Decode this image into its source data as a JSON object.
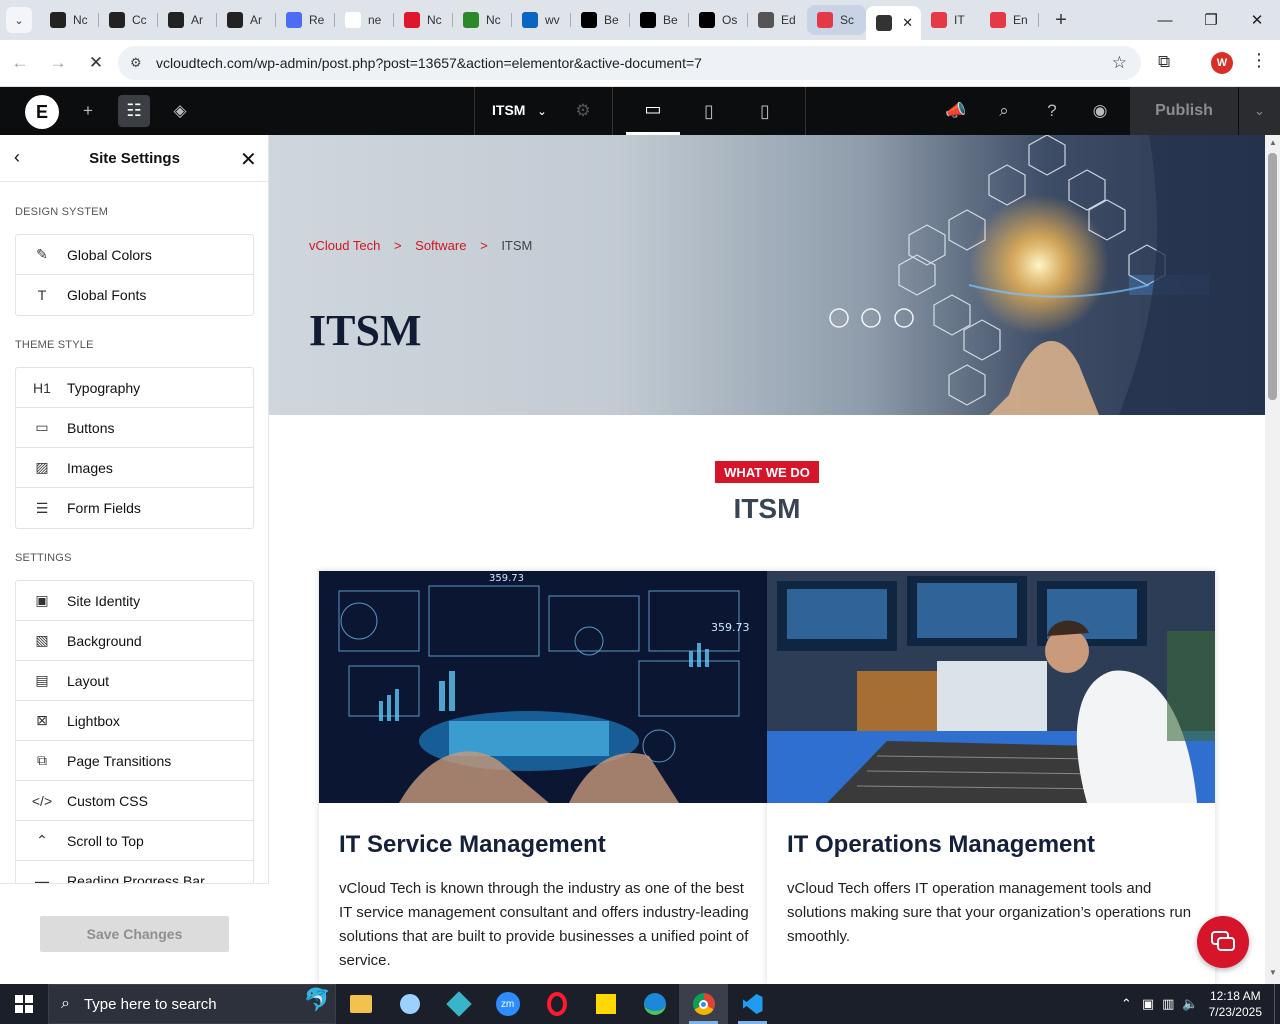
{
  "browser": {
    "tabs": [
      {
        "label": "Nc",
        "color": "#222222"
      },
      {
        "label": "Cc",
        "color": "#222222"
      },
      {
        "label": "Ar",
        "color": "#222222"
      },
      {
        "label": "Ar",
        "color": "#222222"
      },
      {
        "label": "Re",
        "color": "#4a6cf7"
      },
      {
        "label": "ne",
        "color": "#ffffff"
      },
      {
        "label": "Nc",
        "color": "#e0162b"
      },
      {
        "label": "Nc",
        "color": "#2a8a2a"
      },
      {
        "label": "wv",
        "color": "#0a66c2"
      },
      {
        "label": "Be",
        "color": "#000000"
      },
      {
        "label": "Be",
        "color": "#000000"
      },
      {
        "label": "Os",
        "color": "#000000"
      },
      {
        "label": "Ed",
        "color": "#555555"
      },
      {
        "label": "Sc",
        "color": "#e63946"
      },
      {
        "label": "",
        "color": "#333333"
      },
      {
        "label": "IT",
        "color": "#e63946"
      },
      {
        "label": "En",
        "color": "#e63946"
      }
    ],
    "url": "vcloudtech.com/wp-admin/post.php?post=13657&action=elementor&active-document=7",
    "profile_initial": "W"
  },
  "editor": {
    "doc_name": "ITSM",
    "publish_label": "Publish"
  },
  "panel": {
    "title": "Site Settings",
    "sections": [
      {
        "label": "DESIGN SYSTEM",
        "items": [
          {
            "icon": "brush-icon",
            "glyph": "✎",
            "label": "Global Colors"
          },
          {
            "icon": "font-icon",
            "glyph": "T",
            "label": "Global Fonts"
          }
        ]
      },
      {
        "label": "THEME STYLE",
        "items": [
          {
            "icon": "heading-icon",
            "glyph": "H1",
            "label": "Typography"
          },
          {
            "icon": "button-icon",
            "glyph": "▭",
            "label": "Buttons"
          },
          {
            "icon": "image-icon",
            "glyph": "▨",
            "label": "Images"
          },
          {
            "icon": "form-icon",
            "glyph": "☰",
            "label": "Form Fields"
          }
        ]
      },
      {
        "label": "SETTINGS",
        "items": [
          {
            "icon": "site-identity-icon",
            "glyph": "▣",
            "label": "Site Identity"
          },
          {
            "icon": "background-icon",
            "glyph": "▧",
            "label": "Background"
          },
          {
            "icon": "layout-icon",
            "glyph": "▤",
            "label": "Layout"
          },
          {
            "icon": "lightbox-icon",
            "glyph": "⊠",
            "label": "Lightbox"
          },
          {
            "icon": "page-transitions-icon",
            "glyph": "⧉",
            "label": "Page Transitions"
          },
          {
            "icon": "custom-css-icon",
            "glyph": "</>",
            "label": "Custom CSS"
          },
          {
            "icon": "scroll-top-icon",
            "glyph": "⌃",
            "label": "Scroll to Top"
          },
          {
            "icon": "progress-bar-icon",
            "glyph": "▬",
            "label": "Reading Progress Bar"
          }
        ]
      }
    ],
    "save_label": "Save Changes"
  },
  "page": {
    "breadcrumbs": [
      "vCloud Tech",
      "Software",
      "ITSM"
    ],
    "breadcrumb_sep": ">",
    "hero_title": "ITSM",
    "badge": "WHAT WE DO",
    "section_title": "ITSM",
    "cards": [
      {
        "title": "IT Service Management",
        "text": "vCloud Tech is known through the industry as one of the best IT service management consultant and offers industry-leading solutions that are built to provide businesses a unified point of service."
      },
      {
        "title": "IT Operations Management",
        "text": "vCloud Tech offers IT operation management tools and solutions making sure that your organization’s operations run smoothly."
      }
    ]
  },
  "taskbar": {
    "search_placeholder": "Type here to search",
    "time": "12:18 AM",
    "date": "7/23/2025"
  }
}
